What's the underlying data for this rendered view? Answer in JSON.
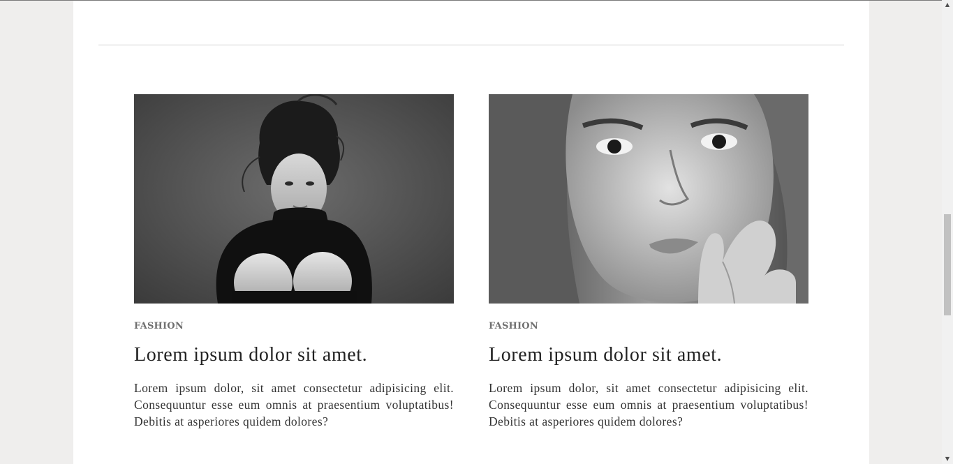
{
  "cards": [
    {
      "category": "FASHION",
      "title": "Lorem ipsum dolor sit amet.",
      "excerpt": "Lorem ipsum dolor, sit amet consectetur adipisicing elit. Consequuntur esse eum omnis at praesentium voluptatibus! Debitis at asperiores quidem dolores?",
      "image_alt": "Black and white portrait of a woman in a black turtleneck"
    },
    {
      "category": "FASHION",
      "title": "Lorem ipsum dolor sit amet.",
      "excerpt": "Lorem ipsum dolor, sit amet consectetur adipisicing elit. Consequuntur esse eum omnis at praesentium voluptatibus! Debitis at asperiores quidem dolores?",
      "image_alt": "Black and white close-up portrait of a woman's face"
    }
  ],
  "scrollbar": {
    "up_icon": "scroll-up-arrow-icon",
    "down_icon": "scroll-down-arrow-icon",
    "up_glyph": "▲",
    "down_glyph": "▼"
  },
  "colors": {
    "page_background": "#efeeed",
    "content_background": "#ffffff",
    "category_text": "#6f6f6f",
    "headline_text": "#222222",
    "body_text": "#333333"
  }
}
